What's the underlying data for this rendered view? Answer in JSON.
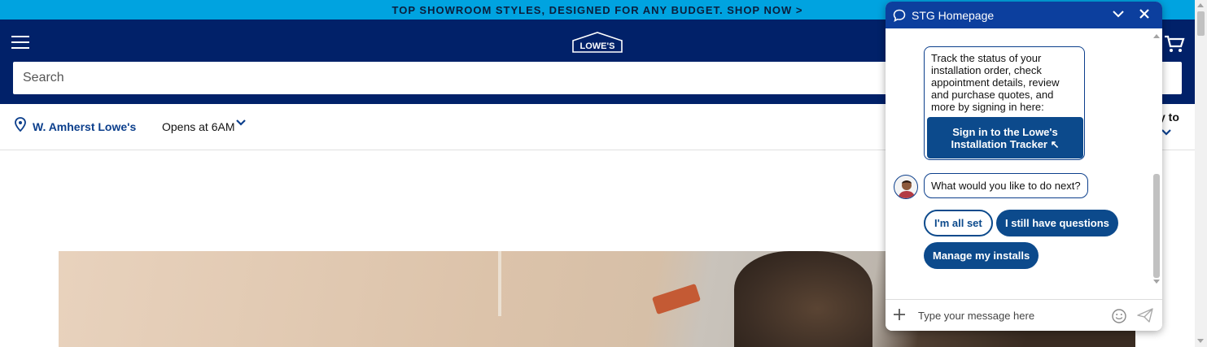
{
  "promo": {
    "text": "TOP SHOWROOM STYLES, DESIGNED FOR ANY BUDGET. SHOP NOW >"
  },
  "header": {
    "logo_text": "LOWE'S",
    "search_placeholder": "Search"
  },
  "store": {
    "name": "W. Amherst Lowe's",
    "hours": "Opens at 6AM",
    "delivery_label": "y to"
  },
  "chat": {
    "title": "STG Homepage",
    "tracker_message": "Track the status of your installation order, check appointment details, review and purchase quotes, and more by signing in here:",
    "signin_button": "Sign in to the Lowe's Installation Tracker ↖",
    "question": "What would you like to do next?",
    "quick_replies": [
      "I'm all set",
      "I still have questions",
      "Manage my installs"
    ],
    "input_placeholder": "Type your message here"
  },
  "colors": {
    "promo_bg": "#00a3e0",
    "header_bg": "#012169",
    "chat_header_bg": "#0c3f9e",
    "button_bg": "#0c4a8c"
  },
  "icons": [
    "menu-icon",
    "cart-icon",
    "location-pin-icon",
    "chevron-down-icon",
    "chat-bubble-icon",
    "minimize-icon",
    "close-icon",
    "plus-icon",
    "emoji-icon",
    "send-icon"
  ]
}
